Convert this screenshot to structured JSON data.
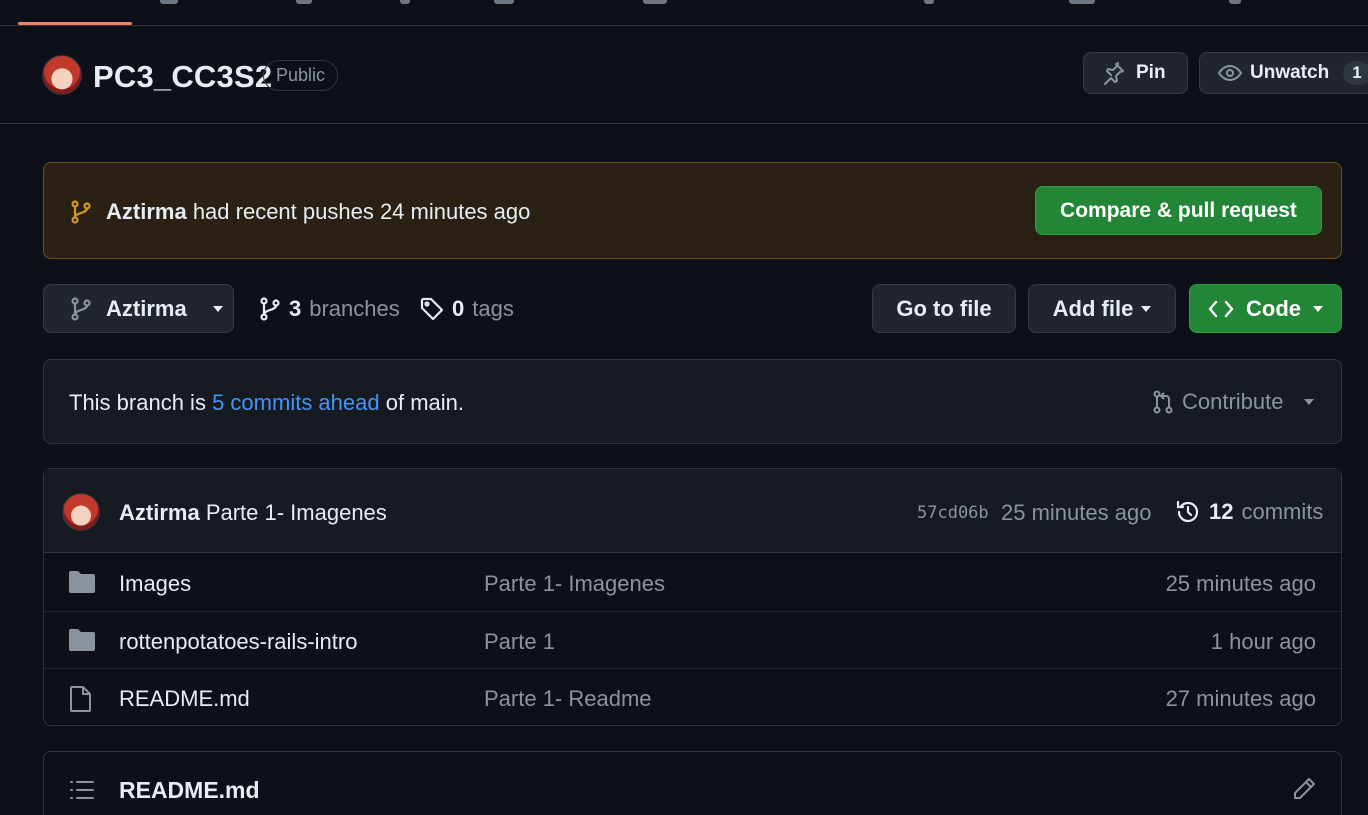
{
  "repo": {
    "name": "PC3_CC3S2",
    "visibility": "Public",
    "pin_label": "Pin",
    "watch_label": "Unwatch",
    "watch_count": "1"
  },
  "banner": {
    "user": "Aztirma",
    "text": "had recent pushes 24 minutes ago",
    "button_label": "Compare & pull request"
  },
  "branch_bar": {
    "current_branch": "Aztirma",
    "branches_count": "3",
    "branches_label": "branches",
    "tags_count": "0",
    "tags_label": "tags",
    "go_to_file": "Go to file",
    "add_file": "Add file",
    "code": "Code"
  },
  "ahead": {
    "prefix": "This branch is",
    "link_text": "5 commits ahead",
    "suffix": "of main.",
    "contribute_label": "Contribute"
  },
  "latest_commit": {
    "author": "Aztirma",
    "message": "Parte 1- Imagenes",
    "sha": "57cd06b",
    "time": "25 minutes ago",
    "commit_count": "12",
    "commit_label": "commits"
  },
  "files": [
    {
      "name": "Images",
      "type": "folder",
      "message": "Parte 1- Imagenes",
      "age": "25 minutes ago"
    },
    {
      "name": "rottenpotatoes-rails-intro",
      "type": "folder",
      "message": "Parte 1",
      "age": "1 hour ago"
    },
    {
      "name": "README.md",
      "type": "file",
      "message": "Parte 1- Readme",
      "age": "27 minutes ago"
    }
  ],
  "readme": {
    "title": "README.md"
  },
  "colors": {
    "accent_green": "#238636",
    "link_blue": "#4493f8",
    "banner_bg": "#2a2114",
    "banner_icon": "#d29922",
    "tab_underline": "#f78166"
  }
}
